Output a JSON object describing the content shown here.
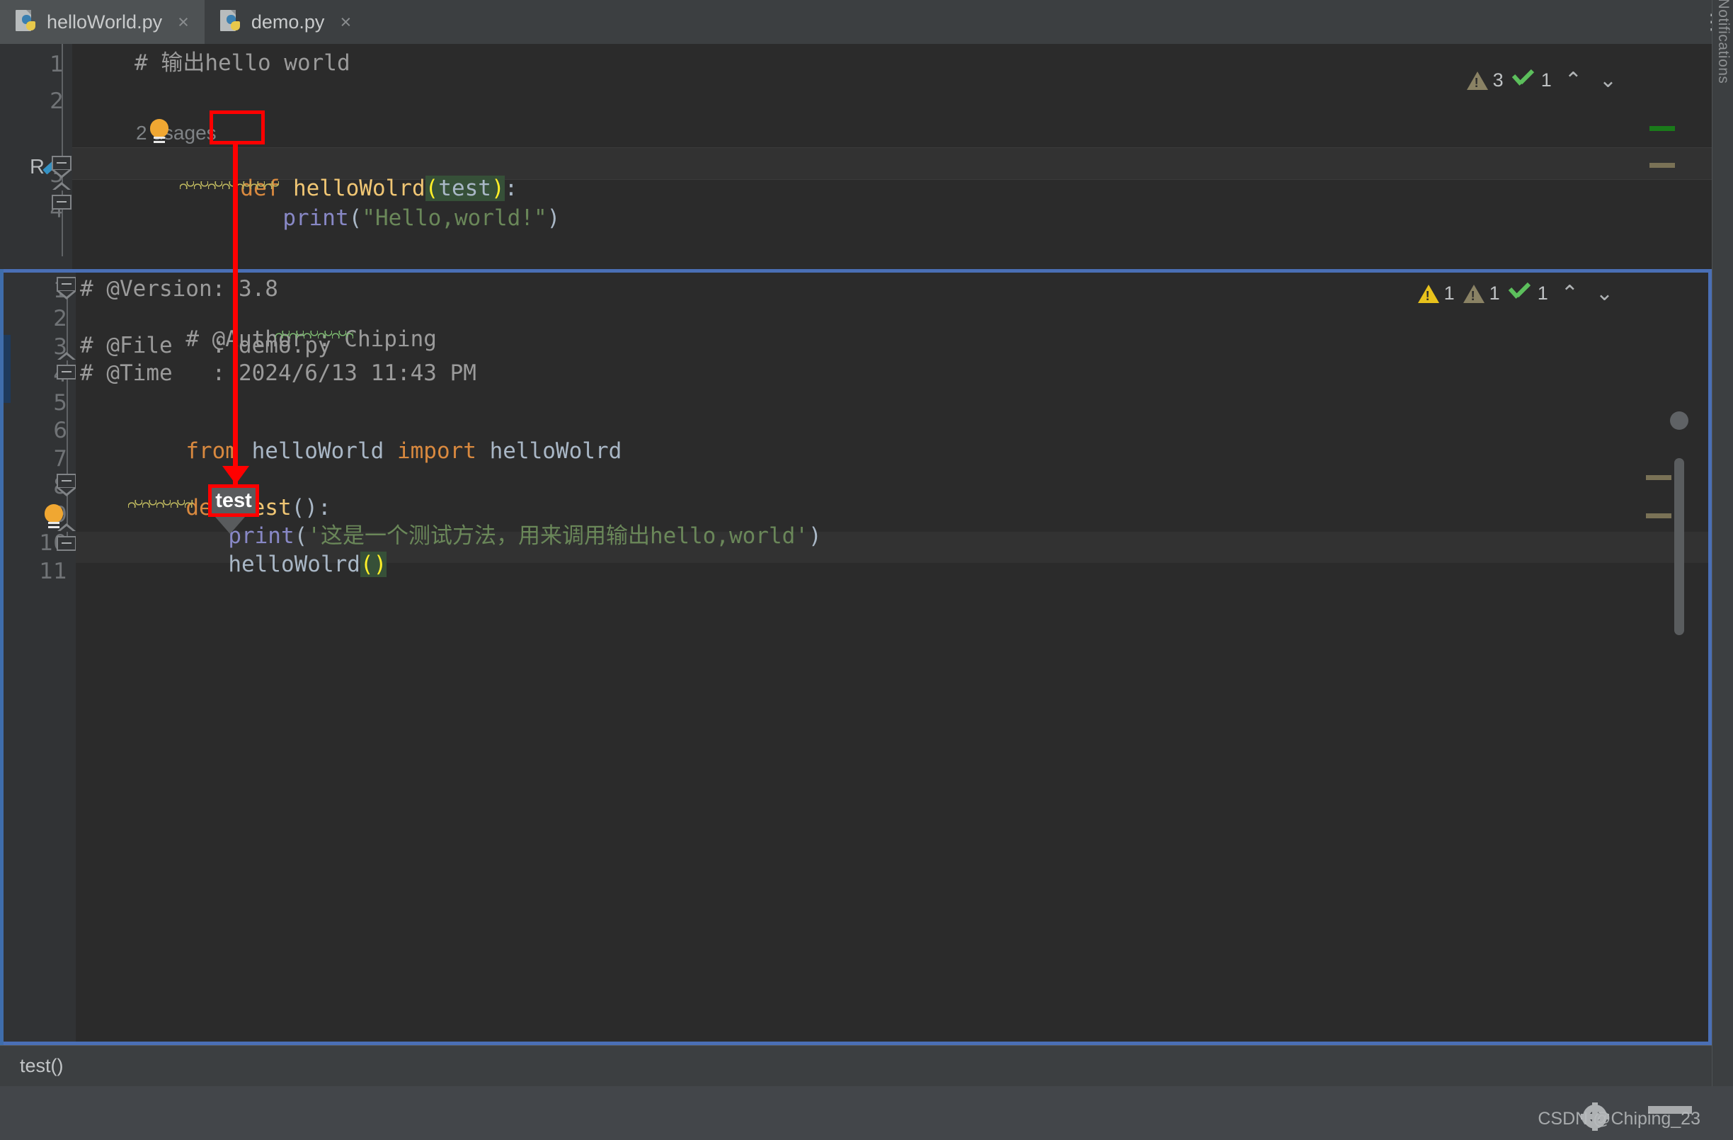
{
  "window": {
    "notifications_label": "Notifications",
    "kebab_icon": "more-options-icon"
  },
  "tabs": [
    {
      "label": "helloWorld.py",
      "active": true,
      "close": "×",
      "icon": "python-file-icon"
    },
    {
      "label": "demo.py",
      "active": false,
      "close": "×",
      "icon": "python-file-icon"
    }
  ],
  "editor1": {
    "file": "helloWorld.py",
    "line_numbers": [
      "1",
      "2",
      "3",
      "4"
    ],
    "inlay_usages": "2 usages",
    "lines": {
      "l1_comment": "# 输出hello world",
      "l3_def": "def",
      "l3_name": "helloWolrd",
      "l3_lparen": "(",
      "l3_param": "test",
      "l3_rparen": ")",
      "l3_colon": ":",
      "l4_print": "print",
      "l4_lparen": "(",
      "l4_string": "\"Hello,world!\"",
      "l4_rparen": ")"
    },
    "inspection": {
      "warning_count": "3",
      "ok_count": "1",
      "up_chevron": "⌃",
      "down_chevron": "⌄"
    },
    "gutter_icons": {
      "run_letter": "R",
      "run_icon_name": "run-configuration-icon"
    }
  },
  "editor2": {
    "file": "demo.py",
    "line_numbers": [
      "1",
      "2",
      "3",
      "4",
      "5",
      "6",
      "7",
      "8",
      "9",
      "10",
      "11"
    ],
    "lines": {
      "l1": "# @Version: 3.8",
      "l2a": "# @Author : ",
      "l2b": "Chiping",
      "l3": "# @File   : demo.py",
      "l4": "# @Time   : 2024/6/13 11:43 PM",
      "l6_from": "from",
      "l6_mod": "helloWorld",
      "l6_import": "import",
      "l6_name": "helloWolrd",
      "l8_def": "def",
      "l8_name": "test",
      "l8_parens": "()",
      "l8_colon": ":",
      "l9_print": "print",
      "l9_lparen": "(",
      "l9_string": "'这是一个测试方法，用来调用输出hello,world'",
      "l9_rparen": ")",
      "l10_name": "helloWolrd",
      "l10_parens": "()"
    },
    "inspection": {
      "warning_yellow_count": "1",
      "warning_tan_count": "1",
      "ok_count": "1",
      "up_chevron": "⌃",
      "down_chevron": "⌄"
    },
    "gutter_icons": {
      "bulb_icon": "lightbulb-intention-icon"
    }
  },
  "annotations": {
    "callout_label": "test",
    "accent_color": "#ff0000"
  },
  "breadcrumb": {
    "text": "test()"
  },
  "watermark": {
    "text": "CSDN @Chiping_23"
  },
  "colors": {
    "editor_background": "#2b2b2b",
    "gutter_background": "#313335",
    "chrome_background": "#3c3f41",
    "focus_border": "#4a6fb5",
    "keyword_orange": "#d9893f",
    "function_yellow": "#f0c674",
    "string_green": "#6a8759",
    "comment_gray": "#9b9b9b",
    "identifier_blue": "#a9b7c6",
    "builtin_purple": "#8888c6",
    "paren_highlight": "#ffef28",
    "annotation_red": "#ff0000"
  }
}
